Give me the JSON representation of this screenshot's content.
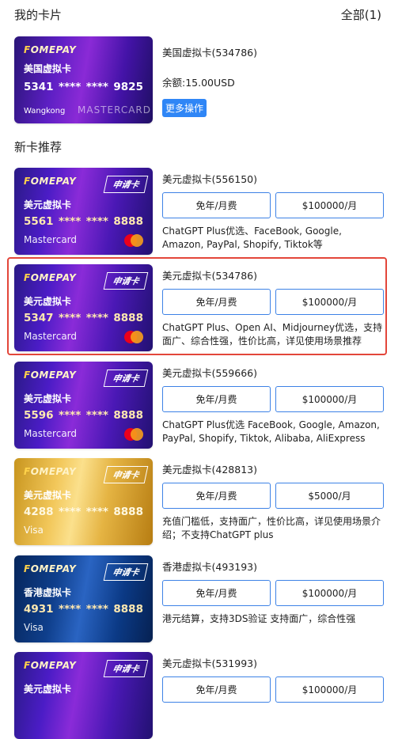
{
  "header": {
    "title": "我的卡片",
    "all": "全部(1)"
  },
  "my_card": {
    "brand": "OMEPAY",
    "card_type": "美国虚拟卡",
    "number": [
      "5341",
      "****",
      "****",
      "9825"
    ],
    "holder": "Wangkong",
    "network": "MASTERCARD",
    "name": "美国虚拟卡(534786)",
    "balance": "余额:15.00USD",
    "more": "更多操作"
  },
  "recommend_title": "新卡推荐",
  "cards": [
    {
      "style": "purple",
      "brand": "OMEPAY",
      "tag": "申请卡",
      "card_type": "美元虚拟卡",
      "number": [
        "5561",
        "****",
        "****",
        "8888"
      ],
      "network": "Mastercard",
      "mc": true,
      "name": "美元虚拟卡(556150)",
      "btn1": "免年/月费",
      "btn2": "$100000/月",
      "desc": "ChatGPT Plus优选、FaceBook, Google, Amazon, PayPal, Shopify, Tiktok等"
    },
    {
      "style": "purple",
      "brand": "OMEPAY",
      "tag": "申请卡",
      "card_type": "美元虚拟卡",
      "number": [
        "5347",
        "****",
        "****",
        "8888"
      ],
      "network": "Mastercard",
      "mc": true,
      "name": "美元虚拟卡(534786)",
      "btn1": "免年/月费",
      "btn2": "$100000/月",
      "desc": "ChatGPT Plus、Open AI、Midjourney优选，支持面广、综合性强，性价比高，详见使用场景推荐"
    },
    {
      "style": "purple",
      "brand": "OMEPAY",
      "tag": "申请卡",
      "card_type": "美元虚拟卡",
      "number": [
        "5596",
        "****",
        "****",
        "8888"
      ],
      "network": "Mastercard",
      "mc": true,
      "name": "美元虚拟卡(559666)",
      "btn1": "免年/月费",
      "btn2": "$100000/月",
      "desc": "ChatGPT Plus优选 FaceBook, Google, Amazon, PayPal, Shopify, Tiktok, Alibaba, AliExpress"
    },
    {
      "style": "gold",
      "brand": "OMEPAY",
      "tag": "申请卡",
      "card_type": "美元虚拟卡",
      "number": [
        "4288",
        "****",
        "****",
        "8888"
      ],
      "network": "Visa",
      "mc": false,
      "name": "美元虚拟卡(428813)",
      "btn1": "免年/月费",
      "btn2": "$5000/月",
      "desc": "充值门槛低，支持面广，性价比高，详见使用场景介绍；不支持ChatGPT plus"
    },
    {
      "style": "blue",
      "brand": "OMEPAY",
      "tag": "申请卡",
      "card_type": "香港虚拟卡",
      "number": [
        "4931",
        "****",
        "****",
        "8888"
      ],
      "network": "Visa",
      "mc": false,
      "name": "香港虚拟卡(493193)",
      "btn1": "免年/月费",
      "btn2": "$100000/月",
      "desc": "港元结算，支持3DS验证 支持面广，综合性强"
    },
    {
      "style": "purple",
      "brand": "OMEPAY",
      "tag": "申请卡",
      "card_type": "美元虚拟卡",
      "number": [
        "",
        "",
        "",
        ""
      ],
      "network": "",
      "mc": false,
      "name": "美元虚拟卡(531993)",
      "btn1": "免年/月费",
      "btn2": "$100000/月",
      "desc": ""
    }
  ]
}
